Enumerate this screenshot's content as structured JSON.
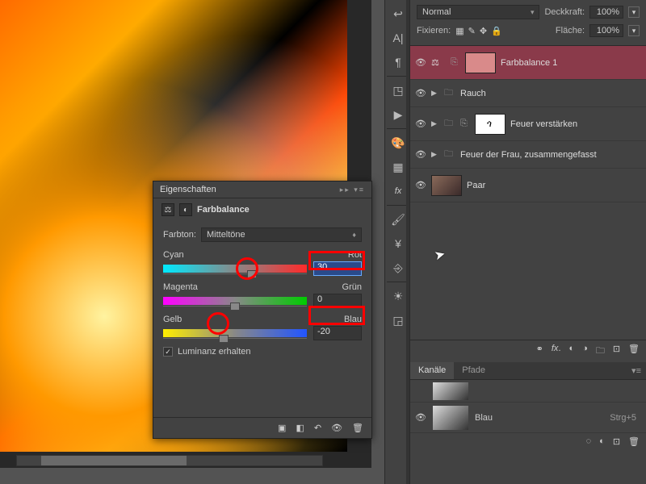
{
  "canvas": {},
  "properties": {
    "panel_title": "Eigenschaften",
    "adjust_title": "Farbbalance",
    "tone_label": "Farbton:",
    "tone_value": "Mitteltöne",
    "sliders": {
      "s1": {
        "left": "Cyan",
        "right": "Rot",
        "value": "30",
        "pos": 62
      },
      "s2": {
        "left": "Magenta",
        "right": "Grün",
        "value": "0",
        "pos": 50
      },
      "s3": {
        "left": "Gelb",
        "right": "Blau",
        "value": "-20",
        "pos": 42
      }
    },
    "luminance_label": "Luminanz erhalten"
  },
  "layer_opts": {
    "blend": "Normal",
    "opacity_label": "Deckkraft:",
    "opacity_value": "100%",
    "lock_label": "Fixieren:",
    "fill_label": "Fläche:",
    "fill_value": "100%"
  },
  "layers": {
    "l1": "Farbbalance 1",
    "l2": "Rauch",
    "l3": "Feuer verstärken",
    "l4": "Feuer der Frau, zusammengefasst",
    "l5": "Paar"
  },
  "channels": {
    "tab1": "Kanäle",
    "tab2": "Pfade",
    "ch_blue": "Blau",
    "ch_blue_short": "Strg+5"
  }
}
